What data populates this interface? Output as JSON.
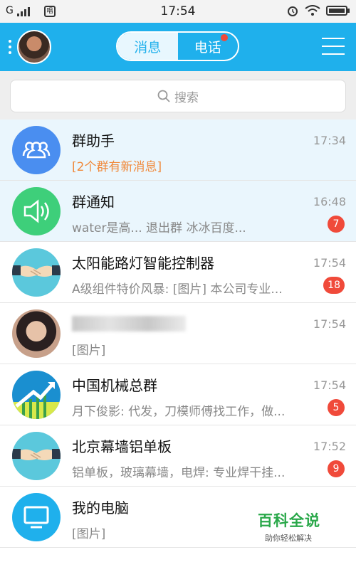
{
  "status_bar": {
    "carrier": "G",
    "time": "17:54",
    "app_icon_text": "唱"
  },
  "header": {
    "tabs": [
      {
        "label": "消息",
        "active": true
      },
      {
        "label": "电话",
        "active": false,
        "has_dot": true
      }
    ]
  },
  "search": {
    "placeholder": "搜索"
  },
  "conversations": [
    {
      "name": "群助手",
      "message": "[2个群有新消息]",
      "time": "17:34",
      "badge": "",
      "icon": "group-helper-icon",
      "color": "#4a8ef0"
    },
    {
      "name": "群通知",
      "message": "water是高... 退出群 冰冰百度...",
      "time": "16:48",
      "badge": "7",
      "icon": "speaker-icon",
      "color": "#3ecf7a"
    },
    {
      "name": "太阳能路灯智能控制器",
      "message": "A级组件特价风暴: [图片] 本公司专业...",
      "time": "17:54",
      "badge": "18",
      "icon": "handshake-icon",
      "color": "#5bc8dc"
    },
    {
      "name": "",
      "message": "[图片]",
      "time": "17:54",
      "badge": "",
      "icon": "user-photo",
      "color": "#c7a08a"
    },
    {
      "name": "中国机械总群",
      "message": "月下俊影: 代发，刀模师傅找工作，做...",
      "time": "17:54",
      "badge": "5",
      "icon": "growth-chart-icon",
      "color": "#1a8fd0"
    },
    {
      "name": "北京幕墙铝单板",
      "message": "铝单板，玻璃幕墙，电焊: 专业焊干挂...",
      "time": "17:52",
      "badge": "9",
      "icon": "handshake-icon",
      "color": "#5bc8dc"
    },
    {
      "name": "我的电脑",
      "message": "[图片]",
      "time": "",
      "badge": "",
      "icon": "computer-icon",
      "color": "#1fb0ec"
    }
  ],
  "watermark": {
    "title": "百科全说",
    "subtitle": "助你轻松解决"
  }
}
